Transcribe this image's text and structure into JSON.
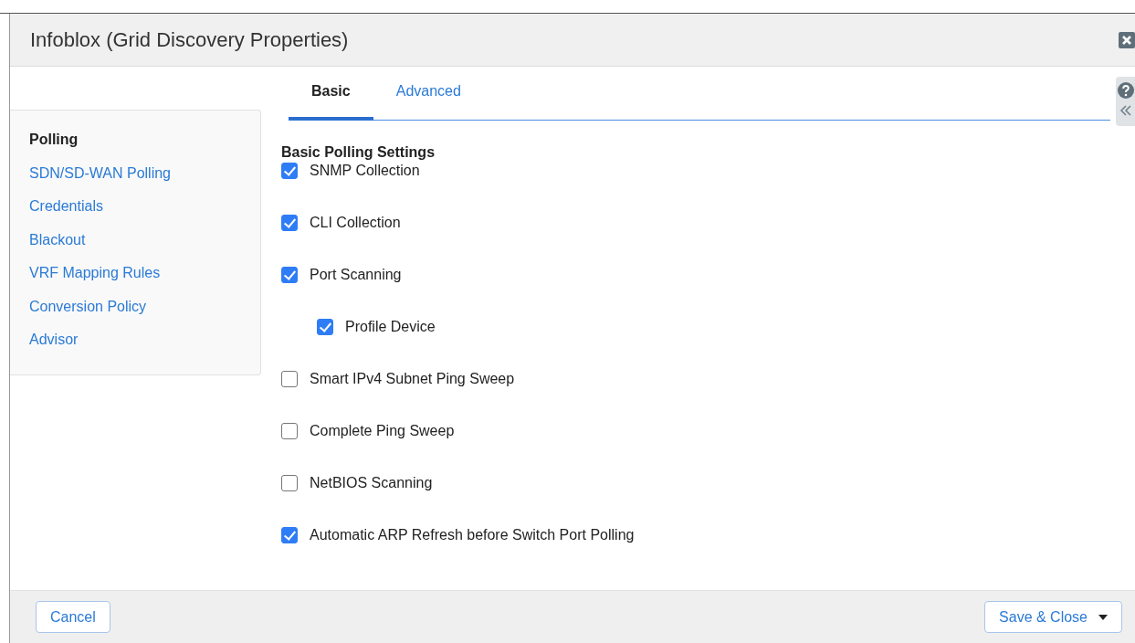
{
  "window": {
    "title": "Infoblox (Grid Discovery Properties)"
  },
  "sidebar": {
    "items": [
      {
        "label": "Polling",
        "selected": true
      },
      {
        "label": "SDN/SD-WAN Polling",
        "selected": false
      },
      {
        "label": "Credentials",
        "selected": false
      },
      {
        "label": "Blackout",
        "selected": false
      },
      {
        "label": "VRF Mapping Rules",
        "selected": false
      },
      {
        "label": "Conversion Policy",
        "selected": false
      },
      {
        "label": "Advisor",
        "selected": false
      }
    ]
  },
  "tabs": [
    {
      "label": "Basic",
      "selected": true
    },
    {
      "label": "Advanced",
      "selected": false
    }
  ],
  "section": {
    "title": "Basic Polling Settings",
    "options": [
      {
        "label": "SNMP Collection",
        "checked": true
      },
      {
        "label": "CLI Collection",
        "checked": true
      },
      {
        "label": "Port Scanning",
        "checked": true,
        "children": [
          {
            "label": "Profile Device",
            "checked": true
          }
        ]
      },
      {
        "label": "Smart IPv4 Subnet Ping Sweep",
        "checked": false
      },
      {
        "label": "Complete Ping Sweep",
        "checked": false
      },
      {
        "label": "NetBIOS Scanning",
        "checked": false
      },
      {
        "label": "Automatic ARP Refresh before Switch Port Polling",
        "checked": true
      }
    ]
  },
  "buttons": {
    "cancel": "Cancel",
    "save": "Save & Close"
  }
}
